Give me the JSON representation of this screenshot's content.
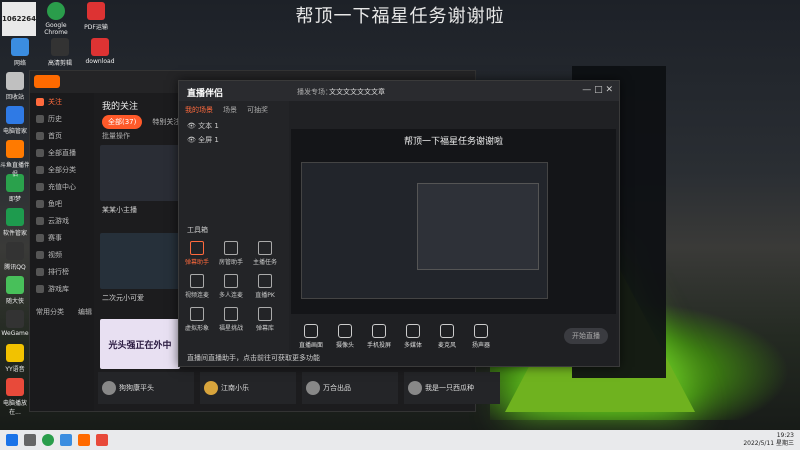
{
  "banner": "帮顶一下福星任务谢谢啦",
  "corner_id": "1062264",
  "desktop_icons_left": [
    {
      "label": "回收站",
      "color": "#c0c0c0"
    },
    {
      "label": "电脑管家",
      "color": "#2f7ae5"
    },
    {
      "label": "斗鱼直播伴侣",
      "color": "#ff7a00"
    },
    {
      "label": "即梦",
      "color": "#2aa14c"
    },
    {
      "label": "软件管家",
      "color": "#1e9b4e"
    },
    {
      "label": "腾讯QQ",
      "color": "#333333"
    },
    {
      "label": "随大侠",
      "color": "#48c05a"
    },
    {
      "label": "WeGame",
      "color": "#333333"
    },
    {
      "label": "YY语音",
      "color": "#f2c200"
    },
    {
      "label": "电脑播放在...",
      "color": "#e84a3a"
    }
  ],
  "desktop_icons_top": [
    {
      "label": "Google Chrome",
      "color": "#2a9d4b"
    },
    {
      "label": "PDF运输",
      "color": "#d33"
    },
    {
      "label": "网络",
      "color": "#3b8de0"
    },
    {
      "label": "高清剪辑",
      "color": "#333"
    },
    {
      "label": "download",
      "color": "#d33"
    }
  ],
  "client": {
    "title": "我的关注",
    "tabs": [
      "全部(37)",
      "特别关注"
    ],
    "batch": "批量操作",
    "sidebar": [
      "关注",
      "历史",
      "首页",
      "全部直播",
      "全部分类",
      "充值中心",
      "鱼吧",
      "云游戏",
      "赛事",
      "视频",
      "排行榜",
      "游戏库",
      "常用分类",
      "编辑"
    ],
    "streamers_row1": [
      "某某小主播",
      "二次元小可爱"
    ],
    "streamer_row2": "光头强正在外中",
    "bottom_cards": [
      "狗狗康平头",
      "江南小乐",
      "万合出品",
      "我是一只西瓜种"
    ]
  },
  "live": {
    "title": "直播伴侣",
    "tabs": [
      "我的场景",
      "场景",
      "可抽奖"
    ],
    "sources": [
      "文本 1",
      "全屏 1"
    ],
    "tool_label": "工具箱",
    "tools": [
      "弹幕助手",
      "房管助手",
      "主播任务",
      "视频连麦",
      "多人连麦",
      "直播PK",
      "虚拟形象",
      "福星挑战",
      "弹幕库"
    ],
    "notice": "直播间直播助手，点击前往可获取更多功能",
    "bottom_buttons": [
      "直播画面",
      "摄像头",
      "手机投屏",
      "多媒体",
      "麦克风",
      "扬声器"
    ],
    "start_button": "开始直播",
    "title_prefix": "播发专场：",
    "room_title": "文文文文文文文章",
    "preview_title": "帮顶一下福星任务谢谢啦"
  },
  "taskbar": {
    "time": "19:23",
    "date": "2022/5/11 星期三"
  }
}
